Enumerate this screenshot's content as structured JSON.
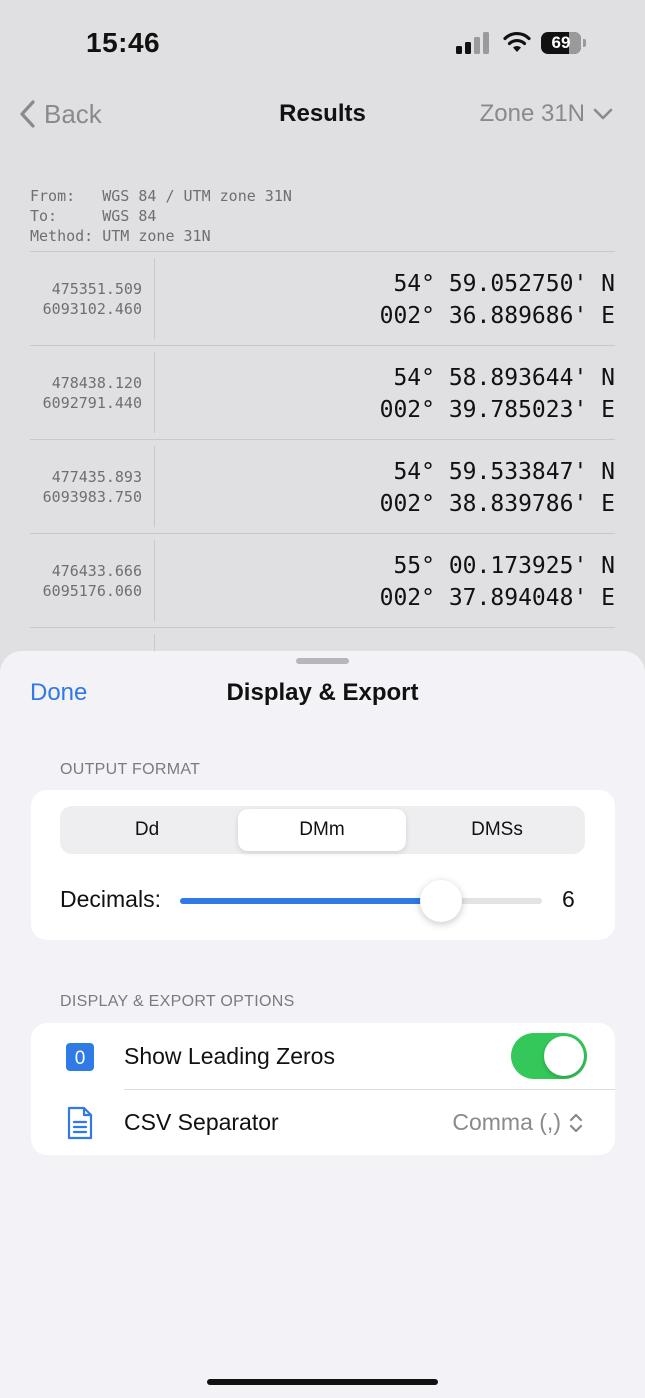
{
  "status_bar": {
    "time": "15:46",
    "battery": "69"
  },
  "nav": {
    "back_label": "Back",
    "title": "Results",
    "zone_label": "Zone 31N"
  },
  "conversion": {
    "meta_lines": [
      "From:   WGS 84 / UTM zone 31N",
      "To:     WGS 84",
      "Method: UTM zone 31N"
    ]
  },
  "results": [
    {
      "easting": "475351.509",
      "northing": "6093102.460",
      "lat": " 54° 59.052750' N",
      "lon": "002° 36.889686' E"
    },
    {
      "easting": "478438.120",
      "northing": "6092791.440",
      "lat": " 54° 58.893644' N",
      "lon": "002° 39.785023' E"
    },
    {
      "easting": "477435.893",
      "northing": "6093983.750",
      "lat": " 54° 59.533847' N",
      "lon": "002° 38.839786' E"
    },
    {
      "easting": "476433.666",
      "northing": "6095176.060",
      "lat": " 55° 00.173925' N",
      "lon": "002° 37.894048' E"
    }
  ],
  "sheet": {
    "done_label": "Done",
    "title": "Display & Export",
    "output_format": {
      "header": "OUTPUT FORMAT",
      "segments": [
        "Dd",
        "DMm",
        "DMSs"
      ],
      "selected": "DMm",
      "decimals_label": "Decimals:",
      "decimals_value": "6",
      "slider_fraction": 0.72
    },
    "options": {
      "header": "DISPLAY & EXPORT OPTIONS",
      "leading_zeros_label": "Show Leading Zeros",
      "leading_zeros_icon_text": "0",
      "leading_zeros_on": true,
      "csv_label": "CSV Separator",
      "csv_value": "Comma (,)"
    }
  },
  "colors": {
    "accent": "#2f7ae5",
    "toggle_on": "#34c759"
  },
  "icons": [
    "back-chevron-icon",
    "chevron-down-icon",
    "document-icon",
    "updown-chevron-icon",
    "zero-badge-icon"
  ]
}
